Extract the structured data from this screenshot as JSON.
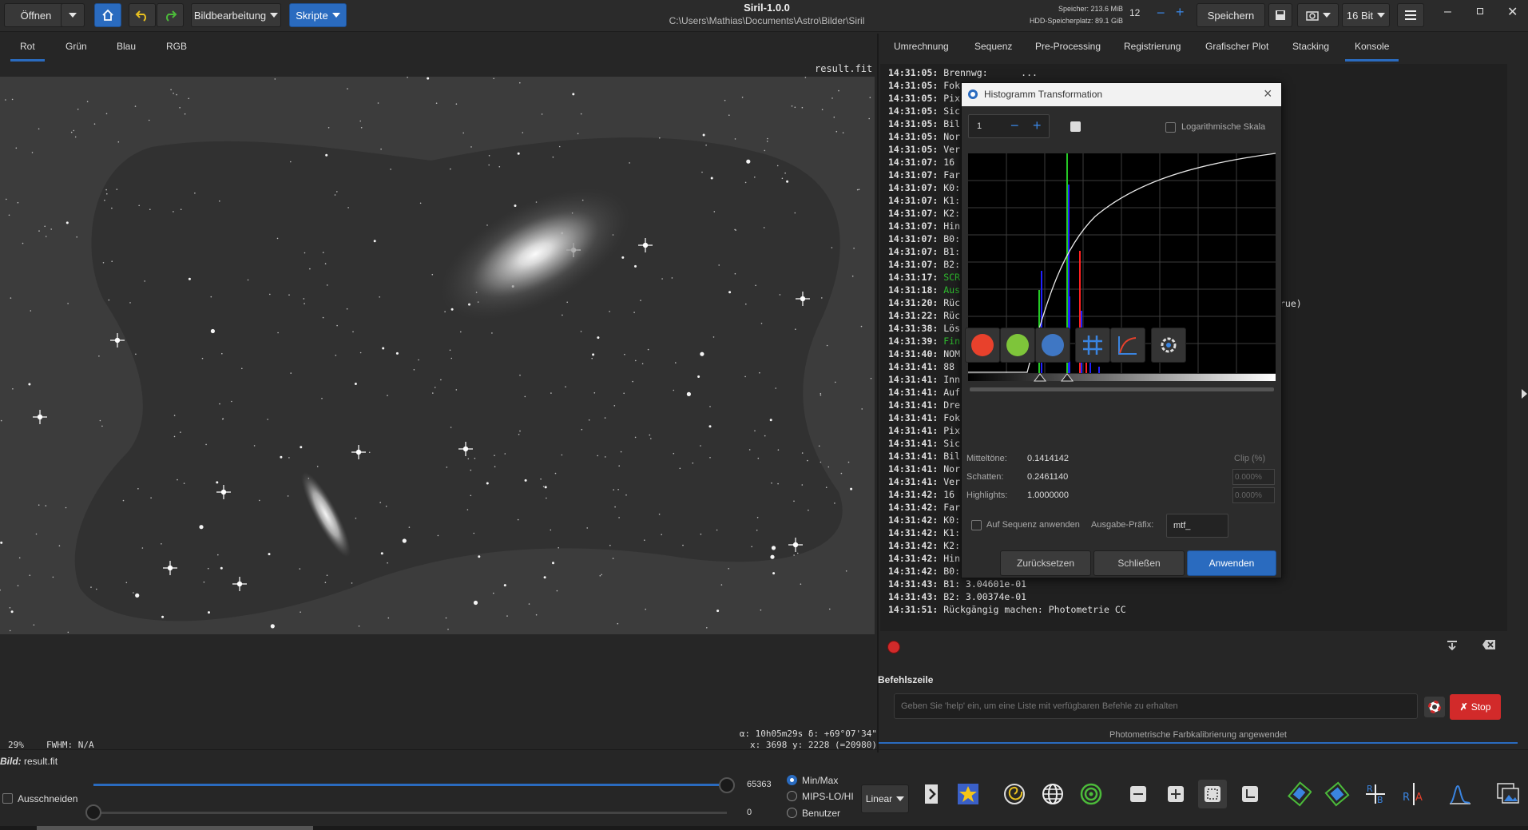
{
  "header": {
    "open_label": "Öffnen",
    "image_edit_label": "Bildbearbeitung",
    "scripts_label": "Skripte",
    "app_title": "Siril-1.0.0",
    "path": "C:\\Users\\Mathias\\Documents\\Astro\\Bilder\\Siril",
    "memory": "Speicher: 213.6 MiB",
    "disk": "HDD-Speicherplatz: 89.1 GiB",
    "threads": "12",
    "save_label": "Speichern",
    "bit_depth": "16 Bit"
  },
  "left_tabs": [
    "Rot",
    "Grün",
    "Blau",
    "RGB"
  ],
  "right_tabs": [
    "Umrechnung",
    "Sequenz",
    "Pre-Processing",
    "Registrierung",
    "Grafischer Plot",
    "Stacking",
    "Konsole"
  ],
  "image": {
    "filename": "result.fit",
    "zoom": "29%",
    "fwhm": "FWHM: N/A",
    "coords_radec": "α: 10h05m29s δ: +69°07'34\"",
    "coords_xy": "x: 3698 y: 2228 (=20980)"
  },
  "console": {
    "lines": [
      {
        "ts": "14:31:05:",
        "msg": " Brennwg:      ...",
        "green": false
      },
      {
        "ts": "14:31:05:",
        "msg": " Fok",
        "green": false
      },
      {
        "ts": "14:31:05:",
        "msg": " Pix",
        "green": false
      },
      {
        "ts": "14:31:05:",
        "msg": " Sic",
        "green": false
      },
      {
        "ts": "14:31:05:",
        "msg": " Bil",
        "green": false
      },
      {
        "ts": "14:31:05:",
        "msg": " Nor",
        "green": false
      },
      {
        "ts": "14:31:05:",
        "msg": " Ver",
        "green": false
      },
      {
        "ts": "14:31:07:",
        "msg": " 16",
        "green": false
      },
      {
        "ts": "14:31:07:",
        "msg": " Far",
        "green": false
      },
      {
        "ts": "14:31:07:",
        "msg": " K0:",
        "green": false
      },
      {
        "ts": "14:31:07:",
        "msg": " K1:",
        "green": false
      },
      {
        "ts": "14:31:07:",
        "msg": " K2:",
        "green": false
      },
      {
        "ts": "14:31:07:",
        "msg": " Hin",
        "green": false
      },
      {
        "ts": "14:31:07:",
        "msg": " B0:",
        "green": false
      },
      {
        "ts": "14:31:07:",
        "msg": " B1:",
        "green": false
      },
      {
        "ts": "14:31:07:",
        "msg": " B2:",
        "green": false
      },
      {
        "ts": "14:31:17:",
        "msg": " SCR",
        "green": true
      },
      {
        "ts": "14:31:18:",
        "msg": " Aus",
        "green": true
      },
      {
        "ts": "14:31:20:",
        "msg": " Rüc",
        "green": false
      },
      {
        "ts": "14:31:22:",
        "msg": " Rüc",
        "green": false
      },
      {
        "ts": "14:31:38:",
        "msg": " Lös",
        "green": false
      },
      {
        "ts": "14:31:39:",
        "msg": " Fin",
        "green": true
      },
      {
        "ts": "14:31:40:",
        "msg": " NOM",
        "green": false
      },
      {
        "ts": "14:31:41:",
        "msg": " 88",
        "green": false
      },
      {
        "ts": "14:31:41:",
        "msg": " Inn",
        "green": false
      },
      {
        "ts": "14:31:41:",
        "msg": " Auf",
        "green": false
      },
      {
        "ts": "14:31:41:",
        "msg": " Dre",
        "green": false
      },
      {
        "ts": "14:31:41:",
        "msg": " Fok",
        "green": false
      },
      {
        "ts": "14:31:41:",
        "msg": " Pix",
        "green": false
      },
      {
        "ts": "14:31:41:",
        "msg": " Sic",
        "green": false
      },
      {
        "ts": "14:31:41:",
        "msg": " Bil",
        "green": false
      },
      {
        "ts": "14:31:41:",
        "msg": " Nor",
        "green": false
      },
      {
        "ts": "14:31:41:",
        "msg": " Ver",
        "green": false
      },
      {
        "ts": "14:31:42:",
        "msg": " 16",
        "green": false
      },
      {
        "ts": "14:31:42:",
        "msg": " Far",
        "green": false
      },
      {
        "ts": "14:31:42:",
        "msg": " K0:",
        "green": false
      },
      {
        "ts": "14:31:42:",
        "msg": " K1:",
        "green": false
      },
      {
        "ts": "14:31:42:",
        "msg": " K2:",
        "green": false
      },
      {
        "ts": "14:31:42:",
        "msg": " Hin",
        "green": false
      },
      {
        "ts": "14:31:42:",
        "msg": " B0:",
        "green": false
      },
      {
        "ts": "14:31:43:",
        "msg": " B1: 3.04601e-01",
        "green": false
      },
      {
        "ts": "14:31:43:",
        "msg": " B2: 3.00374e-01",
        "green": false
      },
      {
        "ts": "14:31:51:",
        "msg": " Rückgängig machen: Photometrie CC",
        "green": false
      }
    ],
    "partial_right": "rue)",
    "command_title": "Befehlszeile",
    "command_placeholder": "Geben Sie 'help' ein, um eine Liste mit verfügbaren Befehle zu erhalten",
    "stop_label": "Stop",
    "status": "Photometrische Farbkalibrierung angewendet"
  },
  "dialog": {
    "title": "Histogramm Transformation",
    "zoom": "1",
    "log_scale_label": "Logarithmische Skala",
    "midtones_label": "Mitteltöne:",
    "midtones_value": "0.1414142",
    "shadows_label": "Schatten:",
    "shadows_value": "0.2461140",
    "highlights_label": "Highlights:",
    "highlights_value": "1.0000000",
    "clip_label": "Clip (%)",
    "clip_shadows": "0.000%",
    "clip_highlights": "0.000%",
    "apply_seq_label": "Auf Sequenz anwenden",
    "prefix_label": "Ausgabe-Präfix:",
    "prefix_value": "mtf_",
    "reset_label": "Zurücksetzen",
    "close_label": "Schließen",
    "apply_label": "Anwenden"
  },
  "bottom": {
    "image_label": "Bild:",
    "image_name": "result.fit",
    "crop_label": "Ausschneiden",
    "max_value": "65363",
    "min_value": "0",
    "mode_minmax": "Min/Max",
    "mode_mips": "MIPS-LO/HI",
    "mode_user": "Benutzer",
    "stretch": "Linear"
  },
  "colors": {
    "accent": "#2a6bbf",
    "stop_red": "#d22a2a"
  }
}
